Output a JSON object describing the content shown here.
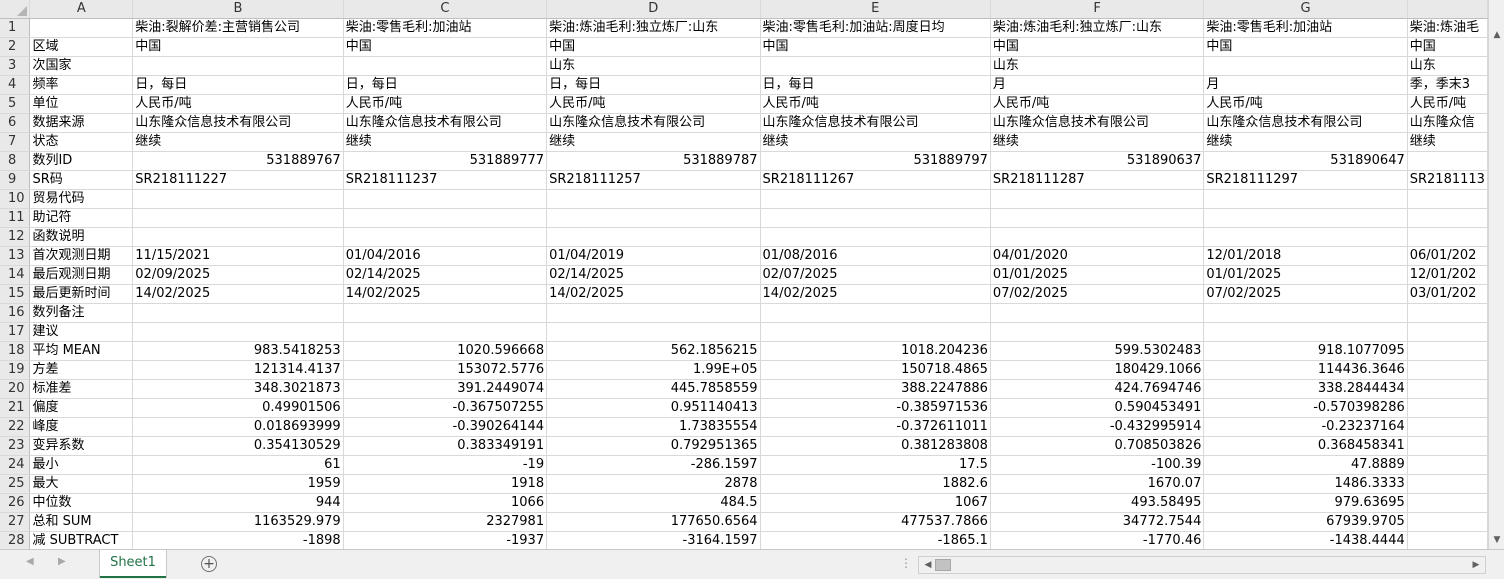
{
  "columns": [
    "A",
    "B",
    "C",
    "D",
    "E",
    "F",
    "G",
    ""
  ],
  "rows": [
    [
      "1",
      "",
      "柴油:裂解价差:主营销售公司",
      "柴油:零售毛利:加油站",
      "柴油:炼油毛利:独立炼厂:山东",
      "柴油:零售毛利:加油站:周度日均",
      "柴油:炼油毛利:独立炼厂:山东",
      "柴油:零售毛利:加油站",
      "柴油:炼油毛"
    ],
    [
      "2",
      "区域",
      "中国",
      "中国",
      "中国",
      "中国",
      "中国",
      "中国",
      "中国"
    ],
    [
      "3",
      "次国家",
      "",
      "",
      "山东",
      "",
      "山东",
      "",
      "山东"
    ],
    [
      "4",
      "频率",
      "日，每日",
      "日，每日",
      "日，每日",
      "日，每日",
      "月",
      "月",
      "季，季末3"
    ],
    [
      "5",
      "单位",
      "人民币/吨",
      "人民币/吨",
      "人民币/吨",
      "人民币/吨",
      "人民币/吨",
      "人民币/吨",
      "人民币/吨"
    ],
    [
      "6",
      "数据来源",
      "山东隆众信息技术有限公司",
      "山东隆众信息技术有限公司",
      "山东隆众信息技术有限公司",
      "山东隆众信息技术有限公司",
      "山东隆众信息技术有限公司",
      "山东隆众信息技术有限公司",
      "山东隆众信"
    ],
    [
      "7",
      "状态",
      "继续",
      "继续",
      "继续",
      "继续",
      "继续",
      "继续",
      "继续"
    ],
    [
      "8",
      "数列ID",
      "531889767",
      "531889777",
      "531889787",
      "531889797",
      "531890637",
      "531890647",
      ""
    ],
    [
      "9",
      "SR码",
      "SR218111227",
      "SR218111237",
      "SR218111257",
      "SR218111267",
      "SR218111287",
      "SR218111297",
      "SR2181113"
    ],
    [
      "10",
      "贸易代码",
      "",
      "",
      "",
      "",
      "",
      "",
      ""
    ],
    [
      "11",
      "助记符",
      "",
      "",
      "",
      "",
      "",
      "",
      ""
    ],
    [
      "12",
      "函数说明",
      "",
      "",
      "",
      "",
      "",
      "",
      ""
    ],
    [
      "13",
      "首次观测日期",
      "11/15/2021",
      "01/04/2016",
      "01/04/2019",
      "01/08/2016",
      "04/01/2020",
      "12/01/2018",
      "06/01/202"
    ],
    [
      "14",
      "最后观测日期",
      "02/09/2025",
      "02/14/2025",
      "02/14/2025",
      "02/07/2025",
      "01/01/2025",
      "01/01/2025",
      "12/01/202"
    ],
    [
      "15",
      "最后更新时间",
      "14/02/2025",
      "14/02/2025",
      "14/02/2025",
      "14/02/2025",
      "07/02/2025",
      "07/02/2025",
      "03/01/202"
    ],
    [
      "16",
      "数列备注",
      "",
      "",
      "",
      "",
      "",
      "",
      ""
    ],
    [
      "17",
      "建议",
      "",
      "",
      "",
      "",
      "",
      "",
      ""
    ],
    [
      "18",
      "平均 MEAN",
      "983.5418253",
      "1020.596668",
      "562.1856215",
      "1018.204236",
      "599.5302483",
      "918.1077095",
      ""
    ],
    [
      "19",
      "方差",
      "121314.4137",
      "153072.5776",
      "1.99E+05",
      "150718.4865",
      "180429.1066",
      "114436.3646",
      ""
    ],
    [
      "20",
      "标准差",
      "348.3021873",
      "391.2449074",
      "445.7858559",
      "388.2247886",
      "424.7694746",
      "338.2844434",
      ""
    ],
    [
      "21",
      "偏度",
      "0.49901506",
      "-0.367507255",
      "0.951140413",
      "-0.385971536",
      "0.590453491",
      "-0.570398286",
      ""
    ],
    [
      "22",
      "峰度",
      "0.018693999",
      "-0.390264144",
      "1.73835554",
      "-0.372611011",
      "-0.432995914",
      "-0.23237164",
      ""
    ],
    [
      "23",
      "变异系数",
      "0.354130529",
      "0.383349191",
      "0.792951365",
      "0.381283808",
      "0.708503826",
      "0.368458341",
      ""
    ],
    [
      "24",
      "最小",
      "61",
      "-19",
      "-286.1597",
      "17.5",
      "-100.39",
      "47.8889",
      ""
    ],
    [
      "25",
      "最大",
      "1959",
      "1918",
      "2878",
      "1882.6",
      "1670.07",
      "1486.3333",
      ""
    ],
    [
      "26",
      "中位数",
      "944",
      "1066",
      "484.5",
      "1067",
      "493.58495",
      "979.63695",
      ""
    ],
    [
      "27",
      "总和 SUM",
      "1163529.979",
      "2327981",
      "177650.6564",
      "477537.7866",
      "34772.7544",
      "67939.9705",
      ""
    ],
    [
      "28",
      "减 SUBTRACT",
      "-1898",
      "-1937",
      "-3164.1597",
      "-1865.1",
      "-1770.46",
      "-1438.4444",
      ""
    ]
  ],
  "sheet_tab": "Sheet1",
  "add_sheet_symbol": "+",
  "ellipsis": "⋮"
}
